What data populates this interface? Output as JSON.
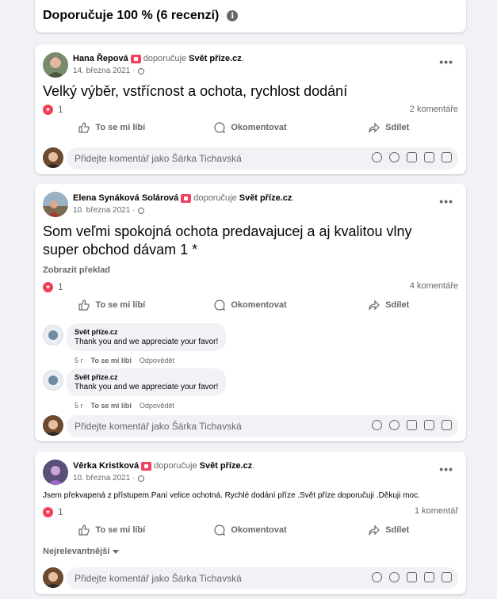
{
  "header": {
    "title": "Doporučuje 100 % (6 recenzí)",
    "info_icon": "info-icon"
  },
  "actions": {
    "like": "To se mi líbí",
    "comment": "Okomentovat",
    "share": "Sdílet"
  },
  "comment_input": {
    "placeholder": "Přidejte komentář jako Šárka Tichavská"
  },
  "posts": [
    {
      "author": "Hana Řepová",
      "verb": "doporučuje",
      "target": "Svět příze.cz",
      "punct": ".",
      "date": "14. března 2021 ·",
      "text": "Velký výběr, vstřícnost a ochota, rychlost dodání",
      "reactions": "1",
      "comments": "2 komentáře"
    },
    {
      "author": "Elena Synáková Solárová",
      "verb": "doporučuje",
      "target": "Svět příze.cz",
      "punct": ".",
      "date": "10. března 2021 ·",
      "text_line1": "Som veľmi spokojná ochota predavajucej a aj kvalitou vlny",
      "text_line2": "super obchod dávam 1 *",
      "translate": "Zobrazit překlad",
      "reactions": "1",
      "comments": "4 komentáře",
      "replies": [
        {
          "name": "Svět příze.cz",
          "text": "Thank you and we appreciate your favor!",
          "time": "5 r",
          "like": "To se mi líbí",
          "reply": "Odpovědět"
        },
        {
          "name": "Svět příze.cz",
          "text": "Thank you and we appreciate your favor!",
          "time": "5 r",
          "like": "To se mi líbí",
          "reply": "Odpovědět"
        }
      ]
    },
    {
      "author": "Věrka Kristková",
      "verb": "doporučuje",
      "target": "Svět příze.cz",
      "punct": ".",
      "date": "10. března 2021 ·",
      "text": "Jsem překvapená z přístupem.Paní velice ochotná. Rychlé dodání příze .Svět příze doporučuji .Děkuji moc.",
      "reactions": "1",
      "comments": "1 komentář",
      "sort": "Nejrelevantnější"
    }
  ]
}
